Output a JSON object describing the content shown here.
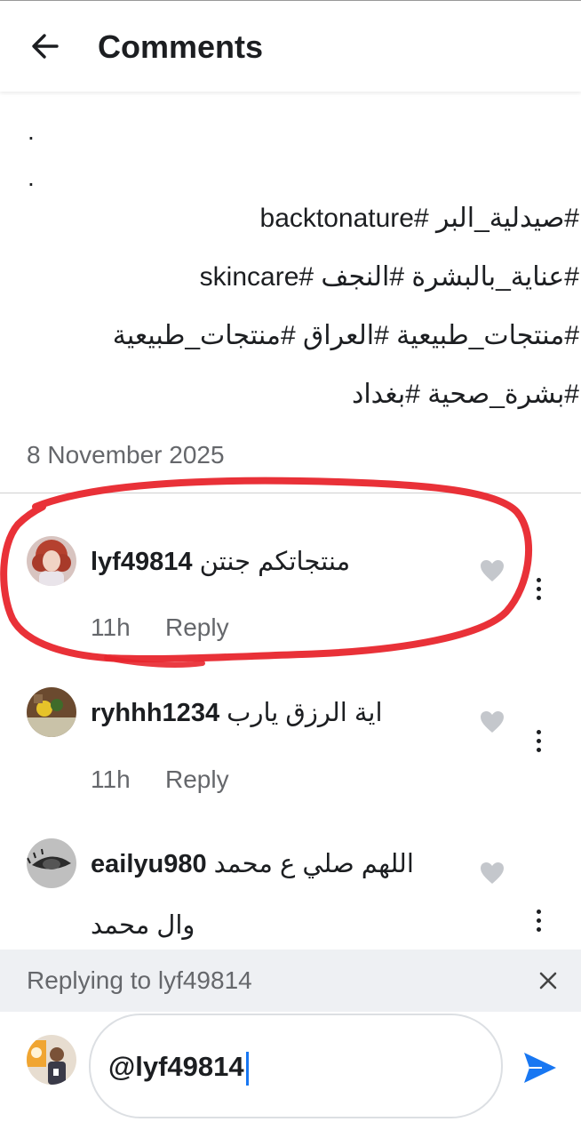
{
  "header": {
    "title": "Comments"
  },
  "post": {
    "dots": [
      ".",
      "."
    ],
    "hashtag_lines": [
      "#صيدلية_البر #backtonature",
      "#عناية_بالبشرة #النجف #skincare",
      "#منتجات_طبيعية #العراق #منتجات_طبيعية",
      "#بشرة_صحية #بغداد"
    ],
    "date": "8 November 2025"
  },
  "comments": [
    {
      "username": "lyf49814",
      "text": "منتجاتكم جنتن",
      "time": "11h",
      "reply_label": "Reply"
    },
    {
      "username": "ryhhh1234",
      "text": "اية الرزق يارب",
      "time": "11h",
      "reply_label": "Reply"
    },
    {
      "username": "eailyu980",
      "text": "اللهم صلي ع محمد",
      "text_line2": "وال محمد"
    }
  ],
  "reply_banner": {
    "text": "Replying to lyf49814"
  },
  "composer": {
    "input_value": "@lyf49814"
  },
  "colors": {
    "accent": "#1877f2",
    "annotation": "#e8262d",
    "muted_text": "#65676b"
  }
}
